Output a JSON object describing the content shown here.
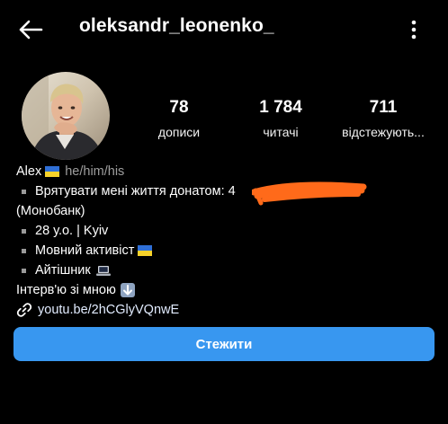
{
  "header": {
    "username": "oleksandr_leonenko_",
    "back_icon": "arrow-left-icon",
    "menu_icon": "more-vertical-icon"
  },
  "stats": {
    "posts": {
      "value": "78",
      "label": "дописи"
    },
    "followers": {
      "value": "1 784",
      "label": "читачі"
    },
    "following": {
      "value": "711",
      "label": "відстежують..."
    }
  },
  "bio": {
    "name": "Alex",
    "pronouns": "he/him/his",
    "donate_line": "Врятувати мені життя донатом: 4",
    "donate_bank": "(Монобанк)",
    "age_city": "28 у.о. | Kyiv",
    "activist": "Мовний активіст",
    "job": "Айтішник",
    "interview": "Інтерв'ю зі мною",
    "link": "youtu.be/2hCGlyVQnwE"
  },
  "actions": {
    "follow_label": "Стежити"
  },
  "colors": {
    "background": "#000000",
    "accent": "#3897f0",
    "redaction": "#ff6a1a",
    "flag_blue": "#2f6fd6",
    "flag_yellow": "#f7d22a"
  }
}
